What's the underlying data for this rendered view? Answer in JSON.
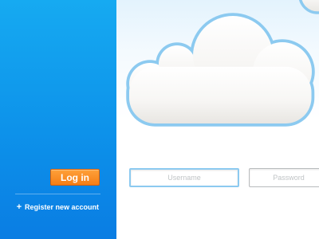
{
  "login": {
    "button_label": "Log in",
    "register_label": "Register new account",
    "register_icon": "+"
  },
  "form": {
    "username_placeholder": "Username",
    "password_placeholder": "Password"
  },
  "colors": {
    "sidebar_top": "#16aaf1",
    "sidebar_bottom": "#0a7de3",
    "button_orange": "#f57e16",
    "cloud_outline": "#8ccaf0"
  },
  "icons": {
    "cloud": "cloud-icon",
    "register": "plus-icon"
  }
}
